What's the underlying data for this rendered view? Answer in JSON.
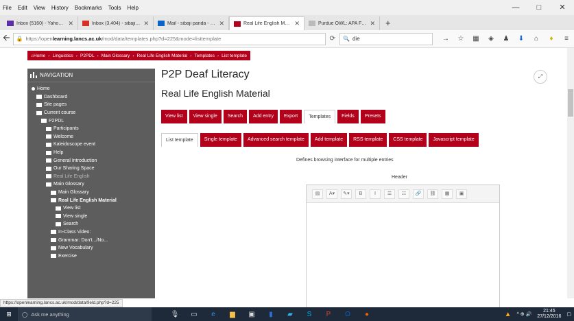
{
  "menubar": {
    "items": [
      "File",
      "Edit",
      "View",
      "History",
      "Bookmarks",
      "Tools",
      "Help"
    ]
  },
  "window_controls": {
    "minimize": "—",
    "maximize": "□",
    "close": "✕"
  },
  "tabs": [
    {
      "title": "Inbox (5160) - Yahoo Mail...",
      "color": "#5a2ea6"
    },
    {
      "title": "Inbox (3,404) - sibajip@g...",
      "color": "#d93025"
    },
    {
      "title": "Mail - sibaji panda - Outlo...",
      "color": "#0a64c8"
    },
    {
      "title": "Real Life English Material",
      "color": "#b3001b"
    },
    {
      "title": "Purdue OWL: APA Formatting ...",
      "color": "#bbbbbb"
    }
  ],
  "newtab_label": "+",
  "urlbar": {
    "prefix": "https://open",
    "domain": "learning.lancs.ac.uk",
    "path": "/mod/data/templates.php?d=225&mode=listtemplate",
    "search_value": "die"
  },
  "breadcrumb": [
    "Home",
    "Linguistics",
    "P2PDL",
    "Main Glossary",
    "Real Life English Material",
    "Templates",
    "List template"
  ],
  "nav": {
    "title": "NAVIGATION",
    "items": [
      {
        "label": "Home",
        "indent": 0,
        "cls": ""
      },
      {
        "label": "Dashboard",
        "indent": 1,
        "cls": ""
      },
      {
        "label": "Site pages",
        "indent": 1,
        "cls": ""
      },
      {
        "label": "Current course",
        "indent": 1,
        "cls": ""
      },
      {
        "label": "P2PDL",
        "indent": 2,
        "cls": ""
      },
      {
        "label": "Participants",
        "indent": 3,
        "cls": ""
      },
      {
        "label": "Welcome",
        "indent": 3,
        "cls": ""
      },
      {
        "label": "Kaleidoscope event",
        "indent": 3,
        "cls": ""
      },
      {
        "label": "Help",
        "indent": 3,
        "cls": ""
      },
      {
        "label": "General Introduction",
        "indent": 3,
        "cls": ""
      },
      {
        "label": "Our Sharing Space",
        "indent": 3,
        "cls": ""
      },
      {
        "label": "Real Life English",
        "indent": 3,
        "cls": "dim"
      },
      {
        "label": "Main Glossary",
        "indent": 3,
        "cls": ""
      },
      {
        "label": "Main Glossary",
        "indent": 4,
        "cls": ""
      },
      {
        "label": "Real Life English Material",
        "indent": 4,
        "cls": "bold"
      },
      {
        "label": "View list",
        "indent": 5,
        "cls": ""
      },
      {
        "label": "View single",
        "indent": 5,
        "cls": ""
      },
      {
        "label": "Search",
        "indent": 5,
        "cls": ""
      },
      {
        "label": "In-Class Video:",
        "indent": 4,
        "cls": ""
      },
      {
        "label": "Grammar: Don't.../No...",
        "indent": 4,
        "cls": ""
      },
      {
        "label": "New Vocabulary",
        "indent": 4,
        "cls": ""
      },
      {
        "label": "Exercise",
        "indent": 4,
        "cls": ""
      }
    ]
  },
  "page": {
    "title": "P2P Deaf Literacy",
    "subtitle": "Real Life English Material",
    "expand_label": "⤢"
  },
  "action_tabs": [
    "View list",
    "View single",
    "Search",
    "Add entry",
    "Export",
    "Templates",
    "Fields",
    "Presets"
  ],
  "action_tabs_selected": "Templates",
  "sub_tabs": [
    "List template",
    "Single template",
    "Advanced search template",
    "Add template",
    "RSS template",
    "CSS template",
    "Javascript template"
  ],
  "sub_tabs_selected": "List template",
  "description": "Defines browsing interface for multiple entries",
  "header_label": "Header",
  "editor_toolbar": [
    "▤",
    "A▾",
    "✎▾",
    "B",
    "I",
    "☰",
    "☷",
    "🔗",
    "⛓",
    "▦",
    "▣"
  ],
  "status_url": "https://openlearning.lancs.ac.uk/mod/data/field.php?d=225",
  "taskbar": {
    "search_placeholder": "Ask me anything",
    "time": "21:45",
    "date": "27/12/2016"
  },
  "accent_color": "#b3001b"
}
